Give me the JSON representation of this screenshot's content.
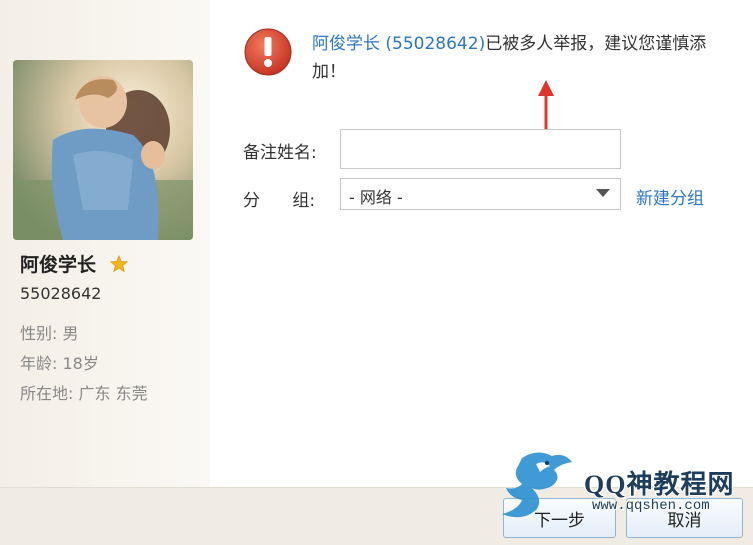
{
  "profile": {
    "nickname": "阿俊学长",
    "qq_number": "55028642",
    "gender": "性别: 男",
    "age": "年龄: 18岁",
    "location": "所在地: 广东  东莞"
  },
  "warning": {
    "name_link": "阿俊学长",
    "number_link": "(55028642)",
    "message": "已被多人举报，建议您谨慎添加！"
  },
  "form": {
    "remark_label": "备注姓名:",
    "remark_value": "",
    "group_label": "分      组:",
    "group_selected": "- 网络 -",
    "new_group_link": "新建分组"
  },
  "buttons": {
    "next": "下一步",
    "cancel": "取消"
  },
  "watermark": {
    "title": "QQ神教程网",
    "url": "www.qqshen.com"
  },
  "colors": {
    "link": "#2b77c3",
    "warning_red": "#d9432f",
    "annotation_arrow": "#e0332b"
  }
}
